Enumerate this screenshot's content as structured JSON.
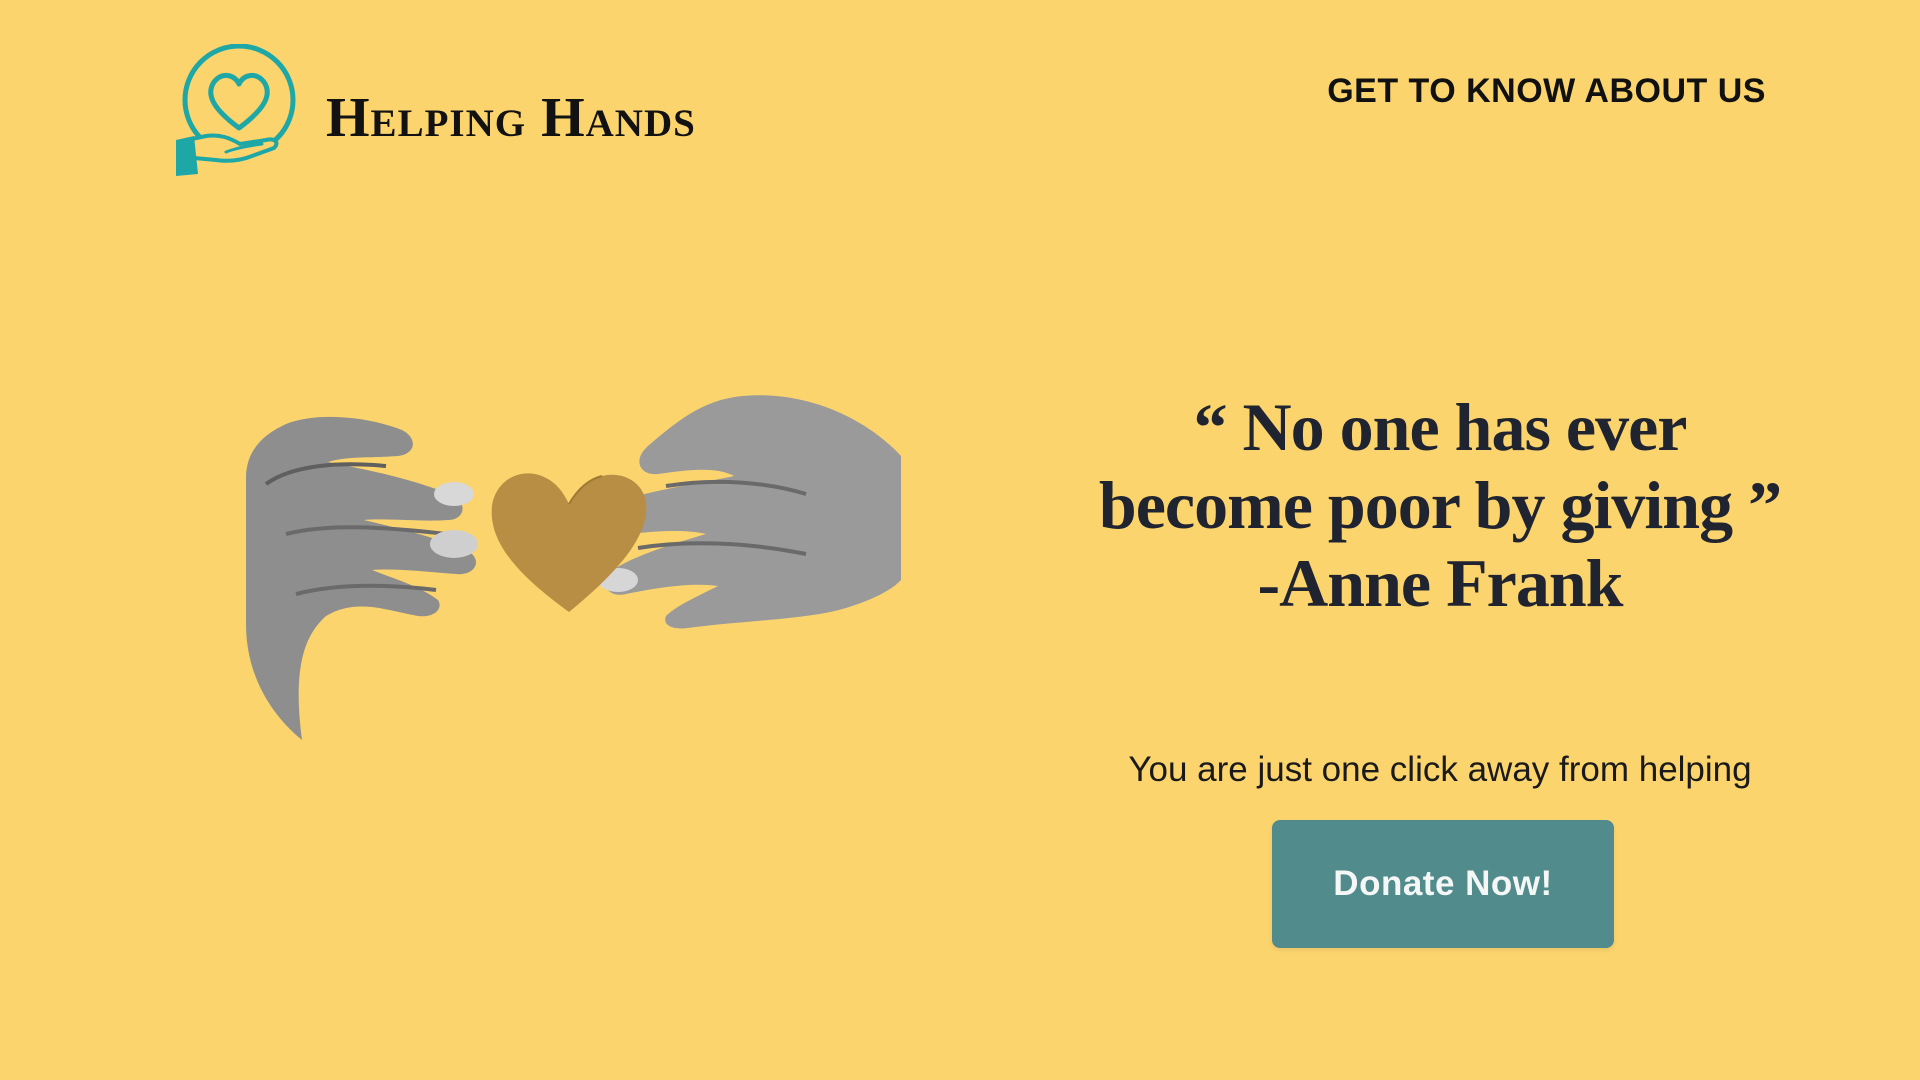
{
  "header": {
    "brand_name": "Helping Hands",
    "logo_icon": "heart-in-hand-icon",
    "nav_link": "GET TO KNOW ABOUT US"
  },
  "hero": {
    "image_subject": "hands-holding-heart-icon",
    "quote": {
      "line1": "“ No one has ever",
      "line2": "become poor by giving ”",
      "line3": "-Anne Frank"
    },
    "cta_caption": "You are just one click away from helping",
    "donate_label": "Donate Now!"
  },
  "colors": {
    "background": "#fbd46d",
    "accent_teal": "#1da7a7",
    "button": "#518b8b",
    "heart": "#b88d44",
    "text_dark": "#1f2430"
  }
}
